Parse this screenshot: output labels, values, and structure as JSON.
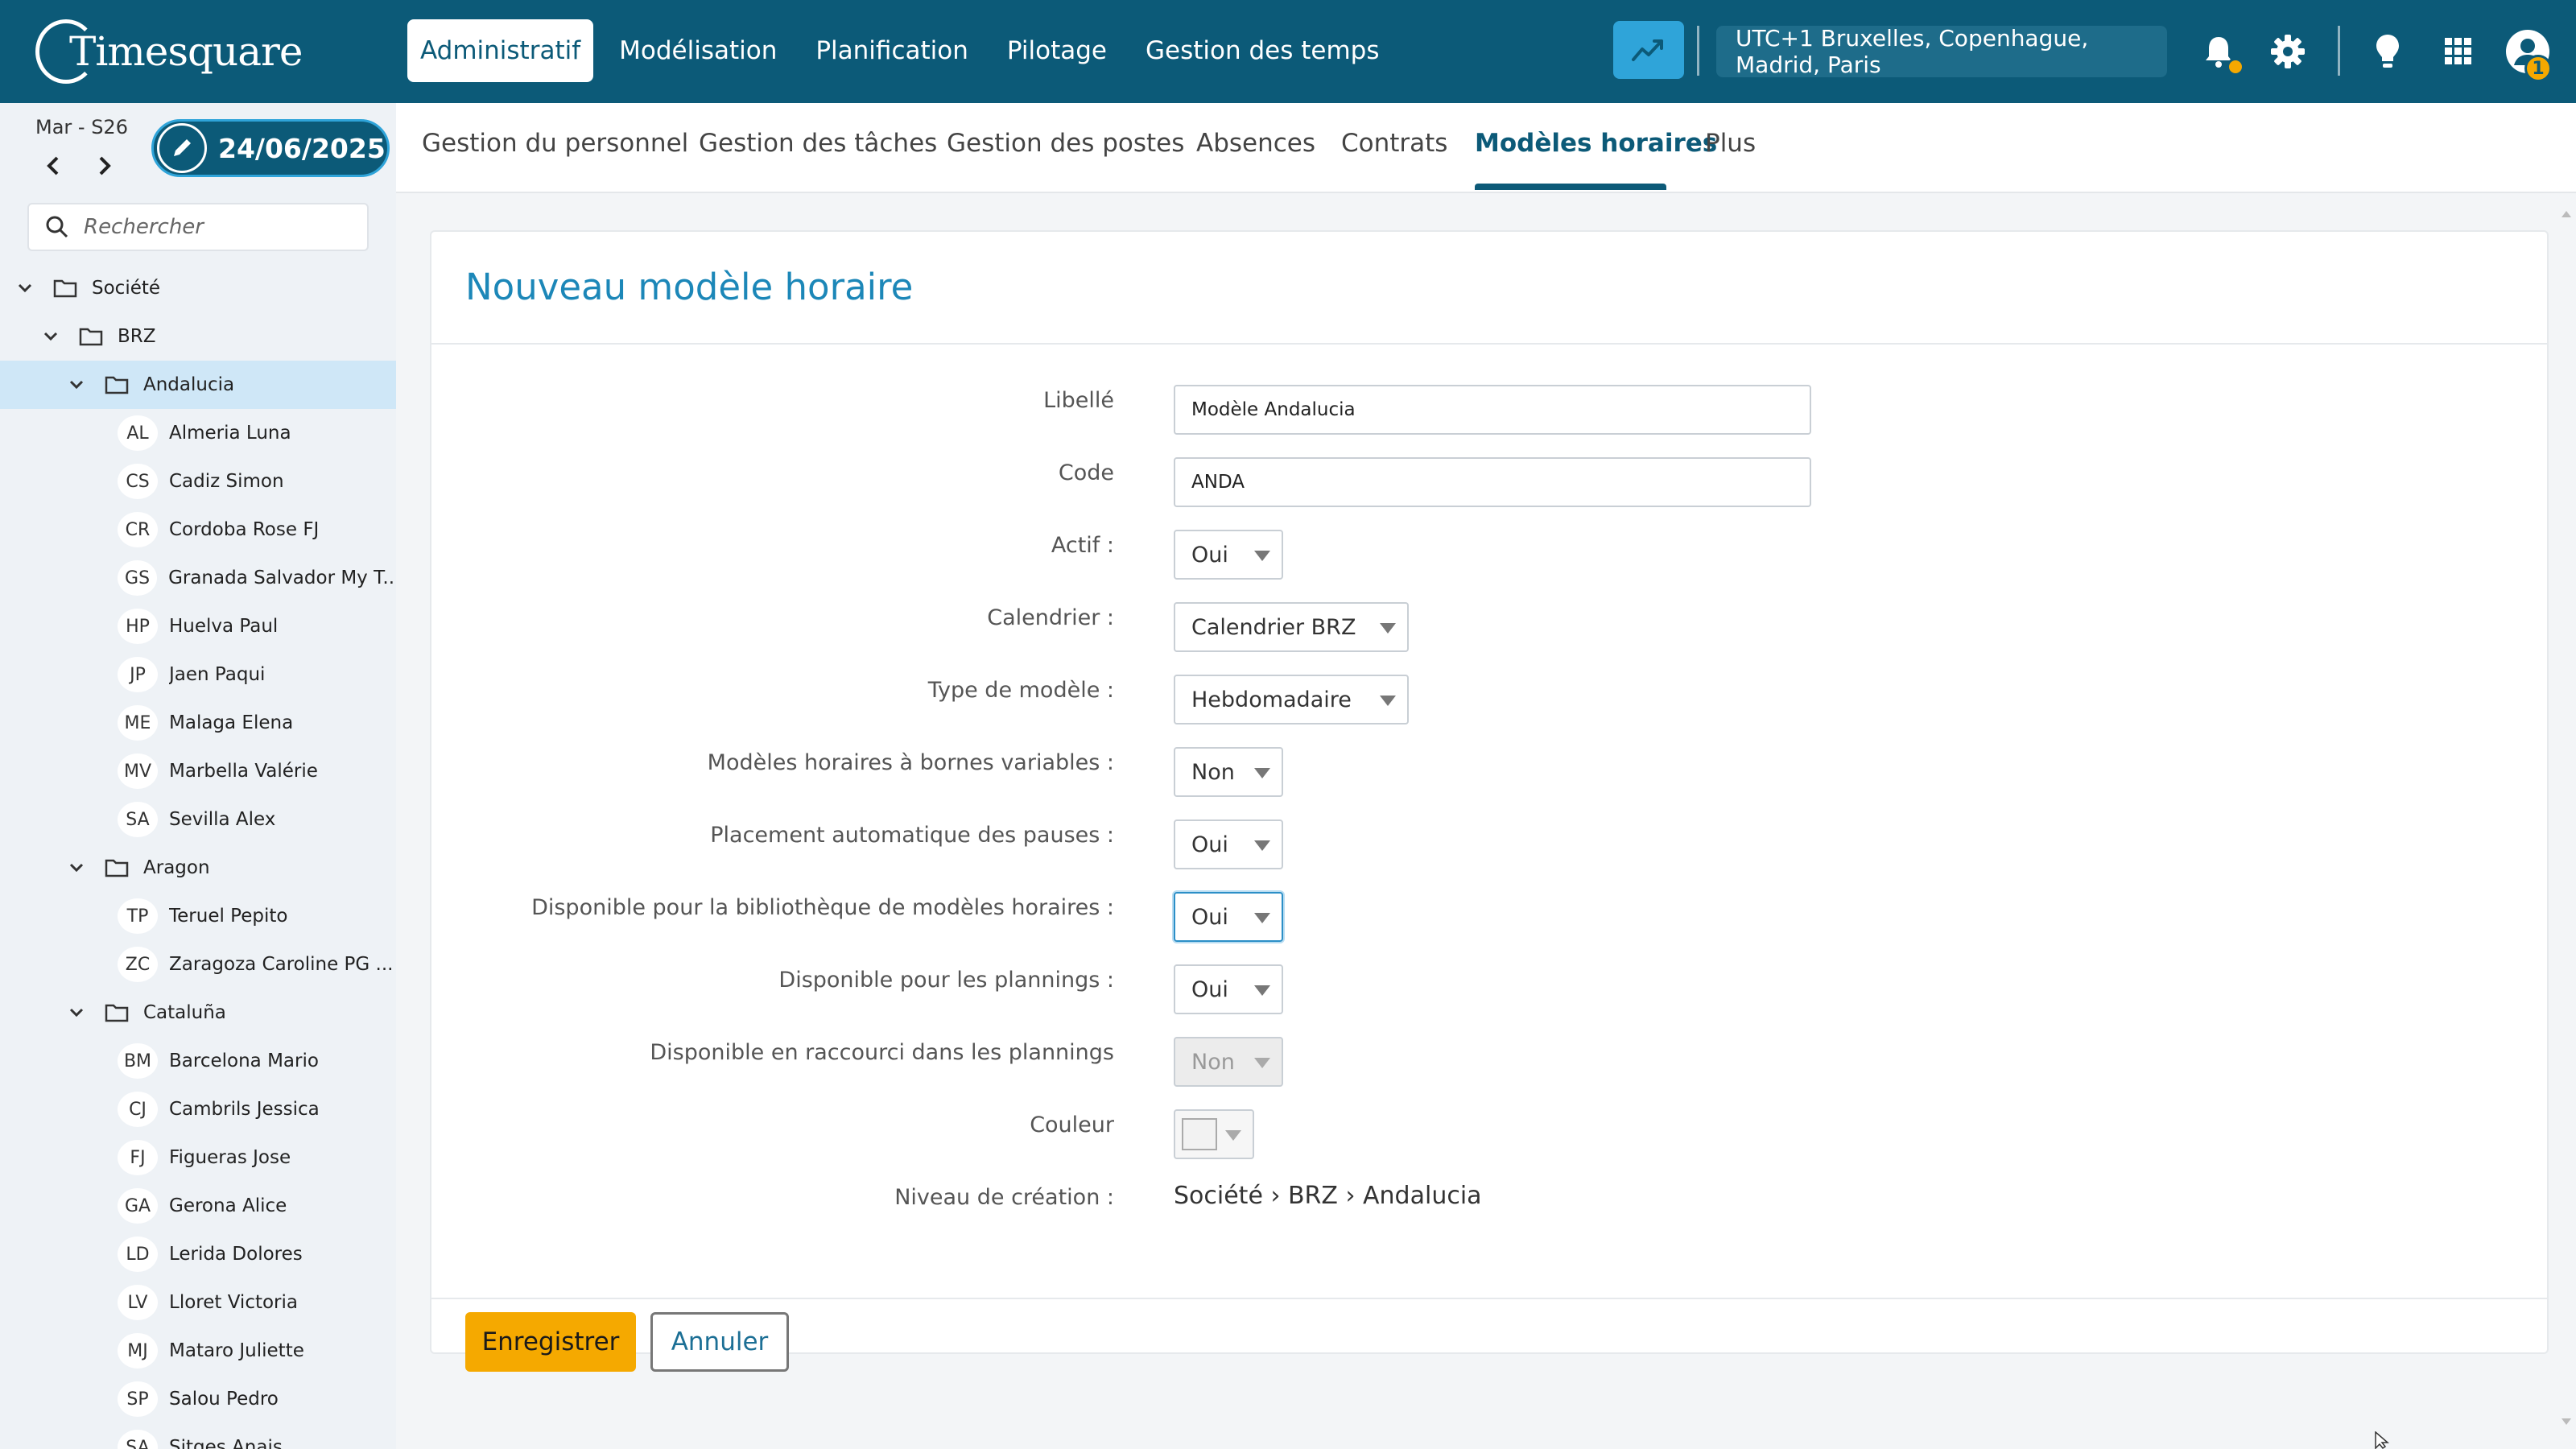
{
  "app": {
    "logo_text": "Timesquare"
  },
  "main_nav": [
    {
      "label": "Administratif",
      "active": true
    },
    {
      "label": "Modélisation"
    },
    {
      "label": "Planification"
    },
    {
      "label": "Pilotage"
    },
    {
      "label": "Gestion des temps"
    }
  ],
  "header": {
    "timezone": "UTC+1 Bruxelles, Copenhague, Madrid, Paris",
    "profile_badge": "1"
  },
  "date": {
    "week": "Mar - S26",
    "current": "24/06/2025"
  },
  "search": {
    "placeholder": "Rechercher"
  },
  "tree": [
    {
      "type": "folder",
      "level": 0,
      "label": "Société"
    },
    {
      "type": "folder",
      "level": 1,
      "label": "BRZ"
    },
    {
      "type": "folder",
      "level": 2,
      "label": "Andalucia",
      "selected": true
    },
    {
      "type": "person",
      "initials": "AL",
      "label": "Almeria Luna"
    },
    {
      "type": "person",
      "initials": "CS",
      "label": "Cadiz Simon"
    },
    {
      "type": "person",
      "initials": "CR",
      "label": "Cordoba Rose FJ"
    },
    {
      "type": "person",
      "initials": "GS",
      "label": "Granada Salvador My T..."
    },
    {
      "type": "person",
      "initials": "HP",
      "label": "Huelva Paul"
    },
    {
      "type": "person",
      "initials": "JP",
      "label": "Jaen Paqui"
    },
    {
      "type": "person",
      "initials": "ME",
      "label": "Malaga Elena"
    },
    {
      "type": "person",
      "initials": "MV",
      "label": "Marbella Valérie"
    },
    {
      "type": "person",
      "initials": "SA",
      "label": "Sevilla Alex"
    },
    {
      "type": "folder",
      "level": 2,
      "label": "Aragon"
    },
    {
      "type": "person",
      "initials": "TP",
      "label": "Teruel Pepito"
    },
    {
      "type": "person",
      "initials": "ZC",
      "label": "Zaragoza Caroline PG ..."
    },
    {
      "type": "folder",
      "level": 2,
      "label": "Cataluña"
    },
    {
      "type": "person",
      "initials": "BM",
      "label": "Barcelona Mario"
    },
    {
      "type": "person",
      "initials": "CJ",
      "label": "Cambrils Jessica"
    },
    {
      "type": "person",
      "initials": "FJ",
      "label": "Figueras Jose"
    },
    {
      "type": "person",
      "initials": "GA",
      "label": "Gerona Alice"
    },
    {
      "type": "person",
      "initials": "LD",
      "label": "Lerida Dolores"
    },
    {
      "type": "person",
      "initials": "LV",
      "label": "Lloret Victoria"
    },
    {
      "type": "person",
      "initials": "MJ",
      "label": "Mataro Juliette"
    },
    {
      "type": "person",
      "initials": "SP",
      "label": "Salou Pedro"
    },
    {
      "type": "person",
      "initials": "SA",
      "label": "Sitges Anais"
    }
  ],
  "sub_nav": [
    {
      "label": "Gestion du personnel"
    },
    {
      "label": "Gestion des tâches"
    },
    {
      "label": "Gestion des postes"
    },
    {
      "label": "Absences"
    },
    {
      "label": "Contrats"
    },
    {
      "label": "Modèles horaires",
      "active": true
    },
    {
      "label": "Plus"
    }
  ],
  "form": {
    "title": "Nouveau modèle horaire",
    "libelle": {
      "label": "Libellé",
      "value": "Modèle Andalucia"
    },
    "code": {
      "label": "Code",
      "value": "ANDA"
    },
    "actif": {
      "label": "Actif :",
      "value": "Oui"
    },
    "calendrier": {
      "label": "Calendrier :",
      "value": "Calendrier BRZ"
    },
    "type_modele": {
      "label": "Type de modèle :",
      "value": "Hebdomadaire"
    },
    "bornes_variables": {
      "label": "Modèles horaires à bornes variables :",
      "value": "Non"
    },
    "placement_pauses": {
      "label": "Placement automatique des pauses :",
      "value": "Oui"
    },
    "bibliotheque": {
      "label": "Disponible pour la bibliothèque de modèles horaires :",
      "value": "Oui"
    },
    "plannings": {
      "label": "Disponible pour les plannings :",
      "value": "Oui"
    },
    "raccourci": {
      "label": "Disponible en raccourci dans les plannings",
      "value": "Non"
    },
    "couleur": {
      "label": "Couleur"
    },
    "niveau": {
      "label": "Niveau de création :",
      "value": "Société › BRZ › Andalucia"
    },
    "save_label": "Enregistrer",
    "cancel_label": "Annuler"
  },
  "colors": {
    "primary": "#0c5a78",
    "accent": "#f5a900",
    "link": "#1c87b8",
    "selection": "#cfe7f7"
  }
}
